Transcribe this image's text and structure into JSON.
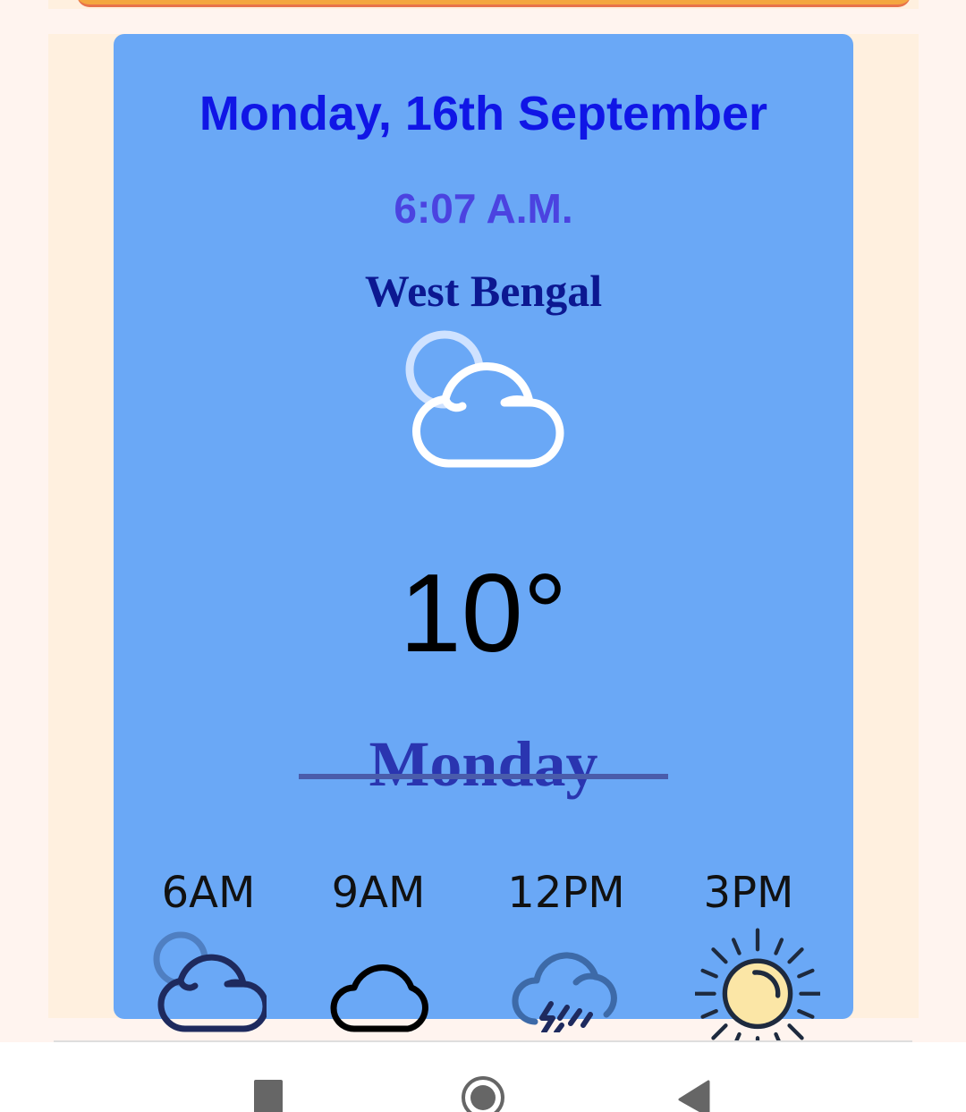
{
  "weather": {
    "date": "Monday, 16th September",
    "time": "6:07 A.M.",
    "location": "West Bengal",
    "condition_icon": "partly-cloudy-icon",
    "temperature": "10°",
    "day_heading": "Monday"
  },
  "hourly": [
    {
      "label": "6AM",
      "icon": "partly-cloudy-icon"
    },
    {
      "label": "9AM",
      "icon": "cloud-icon"
    },
    {
      "label": "12PM",
      "icon": "thunderstorm-rain-icon"
    },
    {
      "label": "3PM",
      "icon": "sun-icon"
    }
  ],
  "navigation": {
    "recent_icon": "square-icon",
    "home_icon": "circle-icon",
    "back_icon": "triangle-back-icon"
  },
  "colors": {
    "card_background": "#6aa8f6",
    "date_text": "#1016e6",
    "time_text": "#4b43e0",
    "location_text": "#0c1891",
    "day_heading_text": "#2a35b0"
  }
}
